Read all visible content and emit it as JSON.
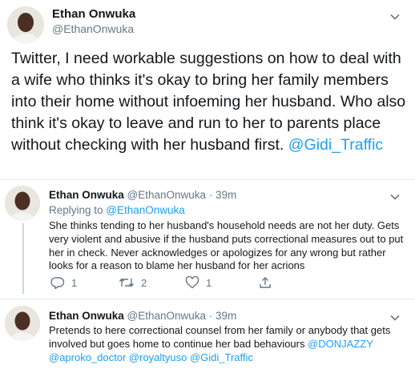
{
  "main_tweet": {
    "author_name": "Ethan Onwuka",
    "author_handle": "@EthanOnwuka",
    "text_before_link": "Twitter, I need workable suggestions on how to deal with a wife who thinks it's okay to bring her family members into their home without infoeming her husband. Who also think it's okay to leave and run to her to parents place without checking with her husband first. ",
    "mention": "@Gidi_Traffic"
  },
  "replies": [
    {
      "author_name": "Ethan Onwuka",
      "author_handle": "@EthanOnwuka · 39m",
      "replying_prefix": "Replying to ",
      "replying_to": "@EthanOnwuka",
      "text": "She thinks tending to her husband's household needs are not her duty. Gets very violent and abusive if the husband puts correctional measures out to put her in check. Never acknowledges or apologizes for any wrong but rather looks for a reason to blame her husband for her acrions",
      "actions": {
        "replies": "1",
        "retweets": "2",
        "likes": "1"
      }
    },
    {
      "author_name": "Ethan Onwuka",
      "author_handle": "@EthanOnwuka · 39m",
      "text": "Pretends to here correctional counsel from her family or anybody that gets involved but goes home to continue her bad behaviours ",
      "mentions": "@DONJAZZY @aproko_doctor @royaltyuso @Gidi_Traffic"
    }
  ],
  "colors": {
    "link": "#1da1f2",
    "muted": "#657786",
    "divider": "#e6ecf0"
  }
}
